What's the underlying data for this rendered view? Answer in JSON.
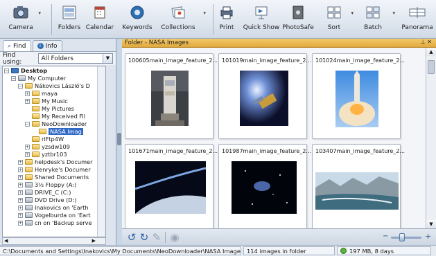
{
  "toolbar": {
    "items": [
      {
        "label": "Camera",
        "icon": "camera-icon"
      },
      {
        "label": "Folders",
        "icon": "folders-icon"
      },
      {
        "label": "Calendar",
        "icon": "calendar-icon"
      },
      {
        "label": "Keywords",
        "icon": "keywords-icon"
      },
      {
        "label": "Collections",
        "icon": "collections-icon"
      },
      {
        "label": "Print",
        "icon": "print-icon"
      },
      {
        "label": "Quick Show",
        "icon": "quick-show-icon"
      },
      {
        "label": "PhotoSafe",
        "icon": "photosafe-icon"
      },
      {
        "label": "Sort",
        "icon": "sort-icon"
      },
      {
        "label": "Batch",
        "icon": "batch-icon"
      },
      {
        "label": "Panorama",
        "icon": "panorama-icon"
      }
    ]
  },
  "left_panel": {
    "tabs": [
      {
        "label": "Find"
      },
      {
        "label": "Info"
      }
    ],
    "find_using_label": "Find using:",
    "find_using_value": "All Folders",
    "tree": [
      {
        "label": "Desktop"
      },
      {
        "label": "My Computer"
      },
      {
        "label": "Nákovics László's D"
      },
      {
        "label": "maya"
      },
      {
        "label": "My Music"
      },
      {
        "label": "My Pictures"
      },
      {
        "label": "My Received Fil"
      },
      {
        "label": "NeoDownloader"
      },
      {
        "label": "NASA Imag"
      },
      {
        "label": "rlFtp4W"
      },
      {
        "label": "yzsdw109"
      },
      {
        "label": "yztbr103"
      },
      {
        "label": "helpdesk's Documer"
      },
      {
        "label": "Henryke's Documer"
      },
      {
        "label": "Shared Documents"
      },
      {
        "label": "3½ Floppy (A:)"
      },
      {
        "label": "DRIVE_C (C:)"
      },
      {
        "label": "DVD Drive (D:)"
      },
      {
        "label": "Inakovics on 'Earth"
      },
      {
        "label": "Vogelburda on 'Eart"
      },
      {
        "label": "cn on 'Backup serve"
      }
    ]
  },
  "content": {
    "folder_title": "Folder - NASA Images",
    "thumbnails": [
      {
        "caption": "100605main_image_feature_2..."
      },
      {
        "caption": "101019main_image_feature_2..."
      },
      {
        "caption": "101024main_image_feature_2..."
      },
      {
        "caption": "101671main_image_feature_2..."
      },
      {
        "caption": "101987main_image_feature_2..."
      },
      {
        "caption": "103407main_image_feature_2..."
      }
    ]
  },
  "status": {
    "path": "C:\\Documents and Settings\\Inakovics\\My Documents\\NeoDownloader\\NASA Images",
    "count": "114 images in folder",
    "size": "197 MB, 8 days"
  },
  "colors": {
    "accent": "#3169c6",
    "folder_bar": "#e2a93c",
    "toolbar_bg": "#dfe6ef"
  }
}
